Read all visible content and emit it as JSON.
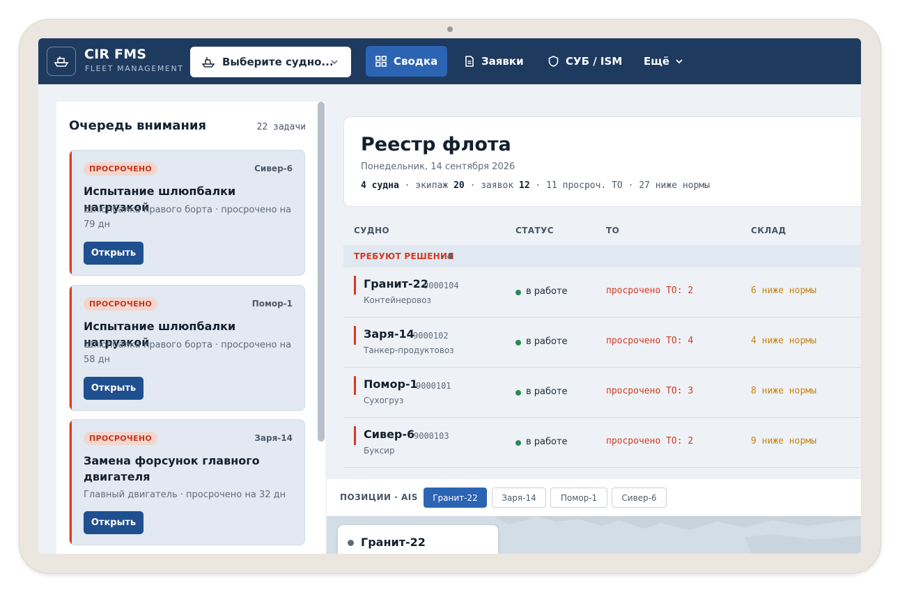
{
  "app": {
    "title": "CIR FMS",
    "subtitle": "FLEET MANAGEMENT"
  },
  "vessel_select": {
    "value": "Выберите судно..."
  },
  "nav": {
    "summary": "Сводка",
    "requests": "Заявки",
    "sms": "СУБ / ISM",
    "more": "Ещё"
  },
  "queue": {
    "title": "Очередь внимания",
    "count": "22 задачи",
    "cards": [
      {
        "badge": "ПРОСРОЧЕНО",
        "ship": "Сивер-6",
        "title": "Испытание шлюпбалки нагрузкой",
        "desc": "Шлюпбалка правого борта · просрочено на 79 дн",
        "button": "Открыть"
      },
      {
        "badge": "ПРОСРОЧЕНО",
        "ship": "Помор-1",
        "title": "Испытание шлюпбалки нагрузкой",
        "desc": "Шлюпбалка правого борта · просрочено на 58 дн",
        "button": "Открыть"
      },
      {
        "badge": "ПРОСРОЧЕНО",
        "ship": "Заря-14",
        "title": "Замена форсунок главного двигателя",
        "desc": "Главный двигатель · просрочено на 32 дн",
        "button": "Открыть"
      }
    ]
  },
  "registry": {
    "title": "Реестр флота",
    "date": "Понедельник, 14 сентября 2026",
    "stats": {
      "vessels": "4 судна",
      "crew_label": "экипаж",
      "crew": "20",
      "requests_label": "заявок",
      "requests": "12",
      "overdue": "11 просроч. ТО",
      "below": "27 ниже нормы",
      "sep": "·"
    }
  },
  "table": {
    "headers": {
      "vessel": "СУДНО",
      "status": "СТАТУС",
      "to": "ТО",
      "stock": "СКЛАД"
    },
    "group": {
      "label": "ТРЕБУЮТ РЕШЕНИЯ",
      "count": "· 4"
    },
    "rows": [
      {
        "name": "Гранит-22",
        "imo": "9000104",
        "type": "Контейнеровоз",
        "status": "в работе",
        "to": "просрочено ТО: 2",
        "stock": "6 ниже нормы"
      },
      {
        "name": "Заря-14",
        "imo": "9000102",
        "type": "Танкер-продуктовоз",
        "status": "в работе",
        "to": "просрочено ТО: 4",
        "stock": "4 ниже нормы"
      },
      {
        "name": "Помор-1",
        "imo": "9000101",
        "type": "Сухогруз",
        "status": "в работе",
        "to": "просрочено ТО: 3",
        "stock": "8 ниже нормы"
      },
      {
        "name": "Сивер-6",
        "imo": "9000103",
        "type": "Буксир",
        "status": "в работе",
        "to": "просрочено ТО: 2",
        "stock": "9 ниже нормы"
      }
    ]
  },
  "ais": {
    "label": "ПОЗИЦИИ · AIS",
    "chips": [
      "Гранит-22",
      "Заря-14",
      "Помор-1",
      "Сивер-6"
    ],
    "active": "Гранит-22",
    "map_card": "Гранит-22"
  },
  "colors": {
    "header": "#1e3a5f",
    "accent": "#2c64b4",
    "danger": "#d23b22",
    "warning": "#c98512",
    "ok": "#2a8a55"
  }
}
